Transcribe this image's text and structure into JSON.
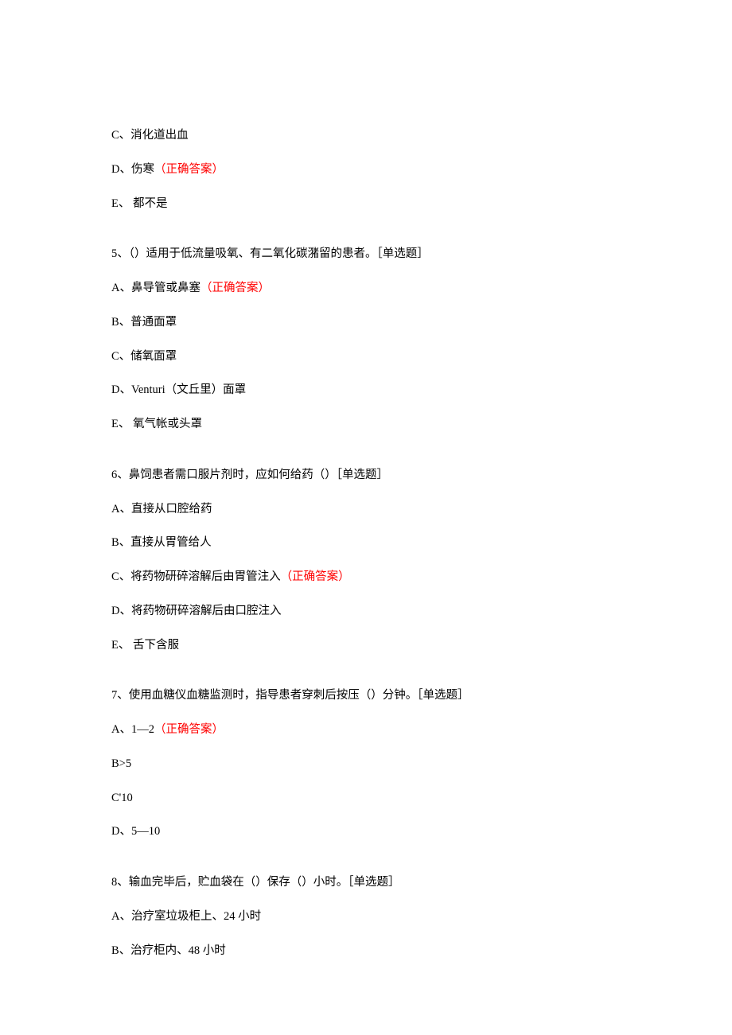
{
  "q4_tail": {
    "optC": "C、消化道出血",
    "optD_pre": "D、伤寒",
    "optD_correct": "（正确答案）",
    "optE": "E、 都不是"
  },
  "q5": {
    "stem": "5、（）适用于低流量吸氧、有二氧化碳潴留的患者。［单选题］",
    "optA_pre": "A、鼻导管或鼻塞",
    "optA_correct": "（正确答案）",
    "optB": "B、普通面罩",
    "optC": "C、储氧面罩",
    "optD": "D、Venturi（文丘里）面罩",
    "optE": "E、 氧气帐或头罩"
  },
  "q6": {
    "stem": "6、鼻饲患者需口服片剂时，应如何给药（）［单选题］",
    "optA": "A、直接从口腔给药",
    "optB": "B、直接从胃管给人",
    "optC_pre": "C、将药物研碎溶解后由胃管注入",
    "optC_correct": "（正确答案）",
    "optD": "D、将药物研碎溶解后由口腔注入",
    "optE": "E、 舌下含服"
  },
  "q7": {
    "stem": "7、使用血糖仪血糖监测时，指导患者穿刺后按压（）分钟。［单选题］",
    "optA_pre": "A、1—2",
    "optA_correct": "（正确答案）",
    "optB": "B>5",
    "optC": "C'10",
    "optD": "D、5—10"
  },
  "q8": {
    "stem": "8、输血完毕后，贮血袋在（）保存（）小时。［单选题］",
    "optA": "A、治疗室垃圾柜上、24 小时",
    "optB": "B、治疗柜内、48 小时"
  }
}
